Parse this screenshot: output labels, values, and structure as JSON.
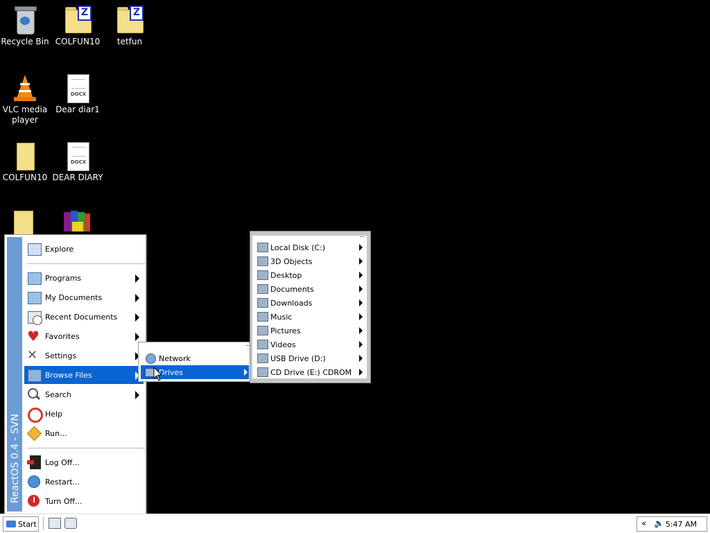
{
  "desktop": {
    "icons": [
      {
        "label": "Recycle Bin",
        "icon": "recycle-bin-icon"
      },
      {
        "label": "COLFUN10",
        "icon": "zip-folder-icon"
      },
      {
        "label": "tetfun",
        "icon": "zip-folder-icon"
      },
      {
        "label": "VLC media player",
        "icon": "vlc-cone-icon"
      },
      {
        "label": "Dear diar1",
        "icon": "docx-file-icon"
      },
      {
        "label": "COLFUN10",
        "icon": "folder-icon"
      },
      {
        "label": "DEAR DIARY",
        "icon": "docx-file-icon"
      }
    ],
    "docx_tag": "DOCX"
  },
  "start_menu": {
    "banner": "ReactOS 0.4 - SVN",
    "items": [
      {
        "label": "Explore",
        "icon": "explore-icon"
      },
      {
        "label": "Programs",
        "icon": "programs-icon"
      },
      {
        "label": "My Documents",
        "icon": "documents-icon"
      },
      {
        "label": "Recent Documents",
        "icon": "clock-icon"
      },
      {
        "label": "Favorites",
        "icon": "heart-icon"
      },
      {
        "label": "Settings",
        "icon": "settings-icon"
      },
      {
        "label": "Browse Files",
        "icon": "folder-icon",
        "selected": true
      },
      {
        "label": "Search",
        "icon": "search-icon"
      },
      {
        "label": "Help",
        "icon": "help-icon"
      },
      {
        "label": "Run...",
        "icon": "run-icon"
      },
      {
        "label": "Log Off...",
        "icon": "logoff-icon"
      },
      {
        "label": "Restart...",
        "icon": "restart-icon"
      },
      {
        "label": "Turn Off...",
        "icon": "power-icon"
      }
    ]
  },
  "browse_menu": {
    "items": [
      {
        "label": "Network",
        "icon": "globe-icon"
      },
      {
        "label": "Drives",
        "icon": "drive-icon",
        "selected": true
      }
    ]
  },
  "drives_menu": {
    "items": [
      {
        "label": "Local Disk (C:)"
      },
      {
        "label": "3D Objects"
      },
      {
        "label": "Desktop"
      },
      {
        "label": "Documents"
      },
      {
        "label": "Downloads"
      },
      {
        "label": "Music"
      },
      {
        "label": "Pictures"
      },
      {
        "label": "Videos"
      },
      {
        "label": "USB Drive (D:)"
      },
      {
        "label": "CD Drive (E:) CDROM"
      }
    ]
  },
  "taskbar": {
    "start_label": "Start",
    "clock": "5:47 AM",
    "chevron": "«"
  },
  "colors": {
    "selection": "#0a64d2",
    "banner": "#6c9cd6",
    "desktop": "#000000"
  }
}
